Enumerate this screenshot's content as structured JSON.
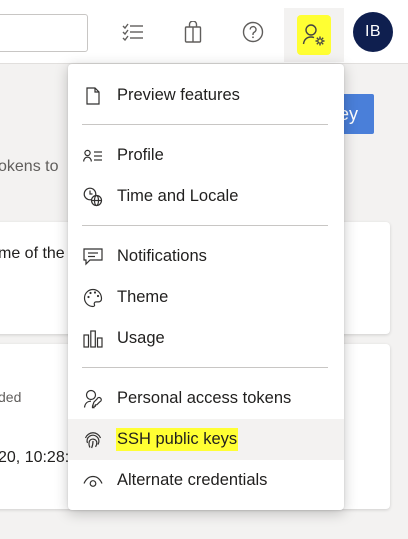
{
  "header": {
    "avatar_initials": "IB",
    "icons": [
      "task-list-icon",
      "shopping-bag-icon",
      "help-icon",
      "user-settings-icon"
    ],
    "highlight_color": "#ffff33"
  },
  "background": {
    "button_label": "ey",
    "tokens_text": "okens to",
    "card1_text": "me of the",
    "card2_header": "ded",
    "card2_value": "20, 10:28:"
  },
  "menu": {
    "items": [
      {
        "label": "Preview features",
        "icon": "document-icon"
      },
      {
        "label": "Profile",
        "icon": "profile-icon"
      },
      {
        "label": "Time and Locale",
        "icon": "clock-globe-icon"
      },
      {
        "label": "Notifications",
        "icon": "chat-icon"
      },
      {
        "label": "Theme",
        "icon": "palette-icon"
      },
      {
        "label": "Usage",
        "icon": "bar-chart-icon"
      },
      {
        "label": "Personal access tokens",
        "icon": "token-icon"
      },
      {
        "label": "SSH public keys",
        "icon": "fingerprint-icon"
      },
      {
        "label": "Alternate credentials",
        "icon": "eye-icon"
      }
    ]
  }
}
